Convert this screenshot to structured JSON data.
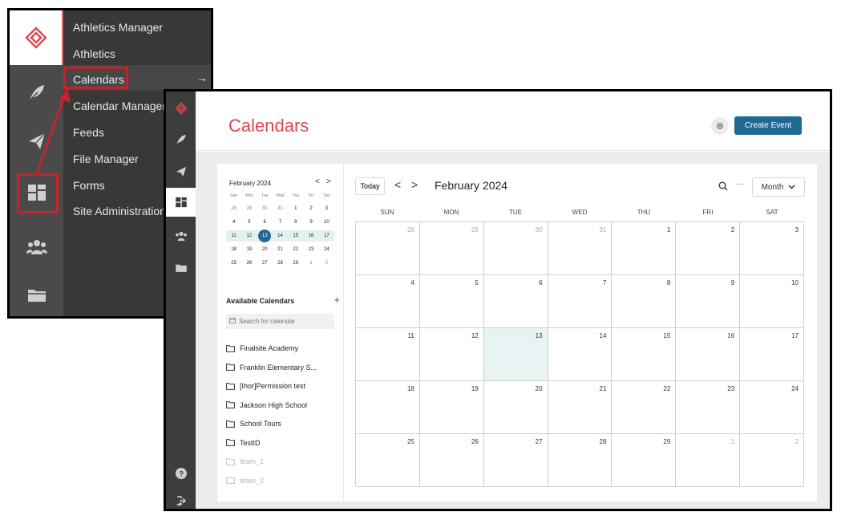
{
  "back_menu": {
    "items": [
      {
        "label": "Athletics Manager"
      },
      {
        "label": "Athletics"
      },
      {
        "label": "Calendars",
        "active": true
      },
      {
        "label": "Calendar Manager"
      },
      {
        "label": "Feeds"
      },
      {
        "label": "File Manager"
      },
      {
        "label": "Forms"
      },
      {
        "label": "Site Administration"
      }
    ],
    "rail_icons": [
      "logo-icon",
      "feather-icon",
      "paper-plane-icon",
      "dashboard-icon",
      "users-icon",
      "folder-icon"
    ],
    "highlight_color": "#c7222a"
  },
  "front": {
    "title": "Calendars",
    "create_button": "Create Event",
    "accent_color": "#e0474f",
    "primary_color": "#1f6a94",
    "rail_icons": [
      "logo-icon",
      "feather-icon",
      "paper-plane-icon",
      "dashboard-icon",
      "users-icon",
      "folder-icon",
      "help-icon",
      "logout-icon"
    ]
  },
  "mini_calendar": {
    "title": "February 2024",
    "prev": "<",
    "next": ">",
    "days_of_week": [
      "Sun",
      "Mon",
      "Tue",
      "Wed",
      "Thu",
      "Fri",
      "Sat"
    ],
    "weeks": [
      [
        "28",
        "29",
        "30",
        "31",
        "1",
        "2",
        "3"
      ],
      [
        "4",
        "5",
        "6",
        "7",
        "8",
        "9",
        "10"
      ],
      [
        "11",
        "12",
        "13",
        "14",
        "15",
        "16",
        "17"
      ],
      [
        "18",
        "19",
        "20",
        "21",
        "22",
        "23",
        "24"
      ],
      [
        "25",
        "26",
        "27",
        "28",
        "29",
        "1",
        "2"
      ]
    ],
    "selected": "13"
  },
  "available_calendars": {
    "title": "Available Calendars",
    "add": "+",
    "search_placeholder": "Search for calendar",
    "items": [
      {
        "label": "Finalsite Academy",
        "muted": false
      },
      {
        "label": "Franklin Elementary S...",
        "muted": false
      },
      {
        "label": "[Ihor]Permission test",
        "muted": false
      },
      {
        "label": "Jackson High School",
        "muted": false
      },
      {
        "label": "School Tours",
        "muted": false
      },
      {
        "label": "TestID",
        "muted": false
      },
      {
        "label": "team_1",
        "muted": true
      },
      {
        "label": "team_2",
        "muted": true
      }
    ]
  },
  "main_calendar": {
    "today_button": "Today",
    "prev": "<",
    "next": ">",
    "month_title": "February 2024",
    "more": "···",
    "view_select": "Month",
    "days_of_week": [
      "SUN",
      "MON",
      "TUE",
      "WED",
      "THU",
      "FRI",
      "SAT"
    ],
    "weeks": [
      [
        "28",
        "29",
        "30",
        "31",
        "1",
        "2",
        "3"
      ],
      [
        "4",
        "5",
        "6",
        "7",
        "8",
        "9",
        "10"
      ],
      [
        "11",
        "12",
        "13",
        "14",
        "15",
        "16",
        "17"
      ],
      [
        "18",
        "19",
        "20",
        "21",
        "22",
        "23",
        "24"
      ],
      [
        "25",
        "26",
        "27",
        "28",
        "29",
        "1",
        "2"
      ]
    ],
    "today": "13"
  }
}
